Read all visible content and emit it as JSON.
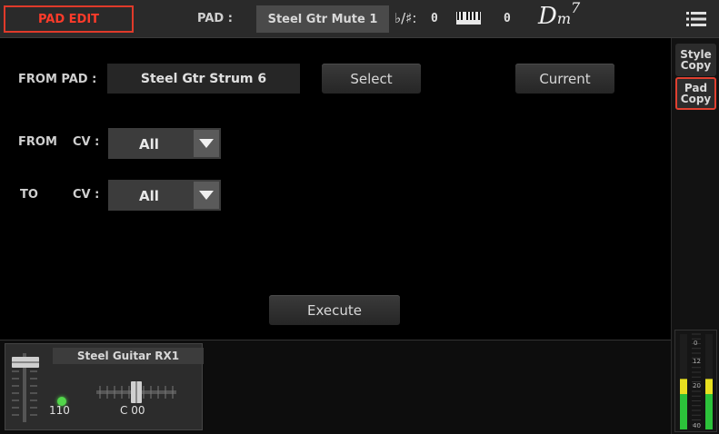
{
  "header": {
    "page_title": "PAD EDIT",
    "pad_label": "PAD :",
    "pad_name": "Steel Gtr Mute 1",
    "transpose_label": "♭/♯:",
    "transpose_value": "0",
    "octave_value": "0",
    "chord_root": "D",
    "chord_quality": "m",
    "chord_extension": "7",
    "menu_icon": "hamburger-menu-icon",
    "keyboard_icon": "keyboard-icon"
  },
  "side_tabs": [
    {
      "label": "Style\nCopy",
      "active": false
    },
    {
      "label": "Pad\nCopy",
      "active": true
    }
  ],
  "main": {
    "from_pad_label": "FROM PAD :",
    "from_pad_value": "Steel Gtr Strum 6",
    "select_button": "Select",
    "current_button": "Current",
    "from_label": "FROM",
    "from_cv_label": "CV :",
    "from_cv_value": "All",
    "to_label": "TO",
    "to_cv_label": "CV :",
    "to_cv_value": "All",
    "execute_button": "Execute"
  },
  "track": {
    "name": "Steel Guitar RX1",
    "volume": "110",
    "pan": "C 00",
    "led_color": "#52d64a"
  },
  "meter": {
    "scale": [
      "0",
      "12",
      "20",
      "40"
    ],
    "level_left": 0.53,
    "level_right": 0.53
  },
  "colors": {
    "accent": "#e03a2a",
    "meter_yellow": "#e8e020",
    "meter_green": "#2cc23a"
  }
}
